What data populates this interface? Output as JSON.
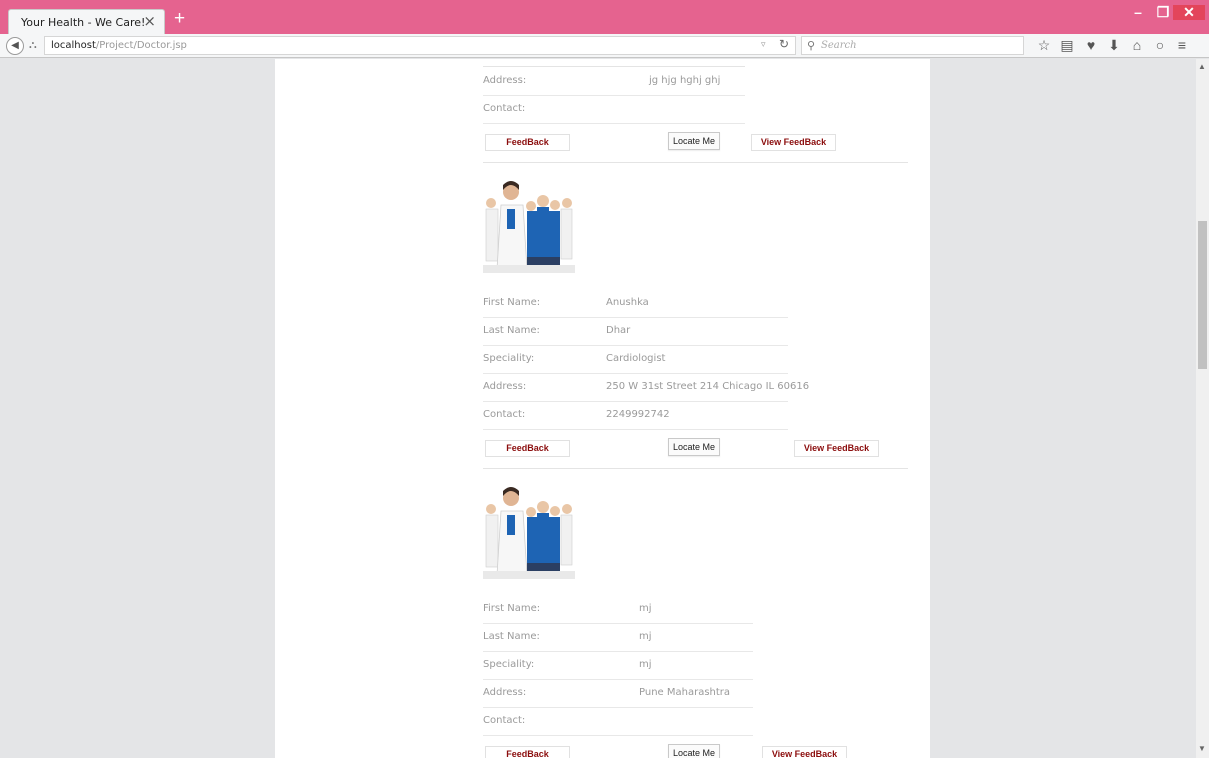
{
  "browser": {
    "tab_title": "Your Health - We Care!",
    "tab_close": "×",
    "new_tab": "+",
    "url_host": "localhost",
    "url_path": "/Project/Doctor.jsp",
    "search_placeholder": "Search",
    "window_controls": {
      "minimize": "–",
      "maximize": "❐",
      "close": "✕"
    },
    "toolbar_icons": [
      "star-icon",
      "reading-list-icon",
      "pocket-icon",
      "download-icon",
      "home-icon",
      "chat-icon",
      "menu-icon"
    ]
  },
  "labels": {
    "first_name": "First Name:",
    "last_name": "Last Name:",
    "speciality": "Speciality:",
    "address": "Address:",
    "contact": "Contact:",
    "feedback": "FeedBack",
    "locate_me": "Locate Me",
    "view_feedback": "View FeedBack"
  },
  "doctors": [
    {
      "address": "jg hjg hghj ghj",
      "contact": ""
    },
    {
      "first_name": "Anushka",
      "last_name": "Dhar",
      "speciality": "Cardiologist",
      "address": "250 W 31st Street 214 Chicago IL 60616",
      "contact": "2249992742"
    },
    {
      "first_name": "mj",
      "last_name": "mj",
      "speciality": "mj",
      "address": "Pune Maharashtra",
      "contact": ""
    }
  ],
  "colors": {
    "titlebar": "#e5638f",
    "button_text": "#8b0d0d",
    "page_bg": "#e4e5e7"
  }
}
